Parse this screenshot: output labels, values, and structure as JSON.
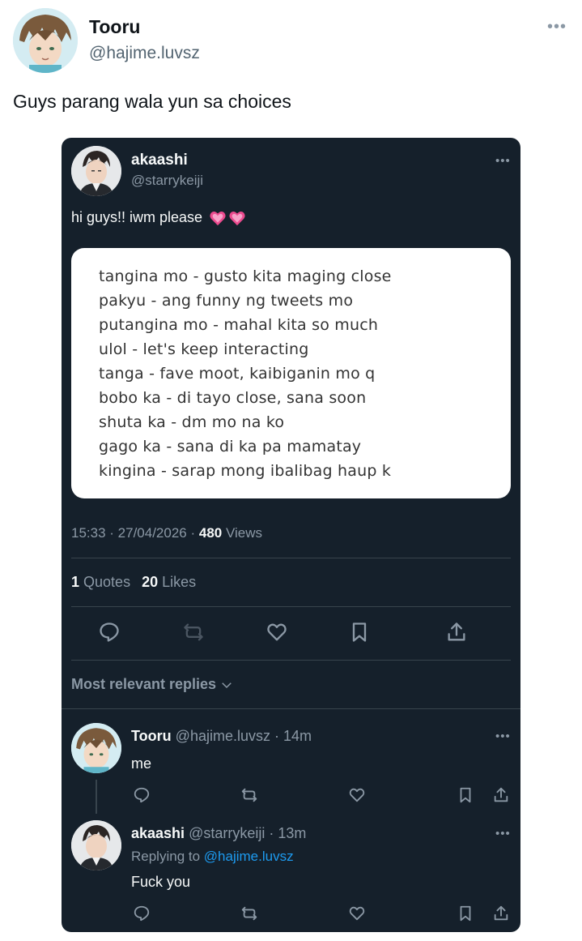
{
  "outer_tweet": {
    "name": "Tooru",
    "handle": "@hajime.luvsz",
    "more": "•••",
    "text": "Guys parang wala yun sa choices"
  },
  "card": {
    "name": "akaashi",
    "handle": "@starrykeiji",
    "more": "•••",
    "text": "hi guys!! iwm please",
    "emoji": "growing-heart-emoji",
    "image_lines": [
      "tangina mo - gusto kita maging close",
      "pakyu - ang funny ng tweets mo",
      "putangina mo - mahal kita so much",
      "ulol - let's keep interacting",
      "tanga - fave moot, kaibiganin mo q",
      "bobo ka - di tayo close, sana soon",
      "shuta ka - dm mo na ko",
      "gago ka - sana di ka pa mamatay",
      "kingina - sarap mong ibalibag haup k"
    ],
    "time": "15:33",
    "date": "27/04/2026",
    "views_count": "480",
    "views_label": "Views",
    "quotes_count": "1",
    "quotes_label": "Quotes",
    "likes_count": "20",
    "likes_label": "Likes",
    "replies_filter": "Most relevant replies",
    "colors": {
      "background": "#15202b",
      "link": "#1d9bf0",
      "muted": "#8b98a5"
    }
  },
  "replies": [
    {
      "name": "Tooru",
      "handle": "@hajime.luvsz",
      "time": "14m",
      "text": "me",
      "more": "•••"
    },
    {
      "name": "akaashi",
      "handle": "@starrykeiji",
      "time": "13m",
      "replying_prefix": "Replying to",
      "replying_handle": "@hajime.luvsz",
      "text": "Fuck you",
      "more": "•••"
    }
  ]
}
